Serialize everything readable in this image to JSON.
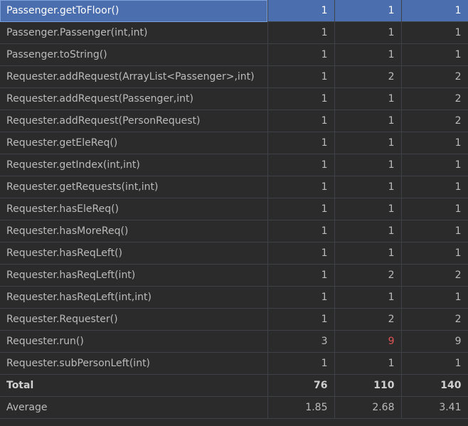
{
  "colors": {
    "background": "#2b2b2b",
    "selected_row": "#4b6eaf",
    "highlight_value": "#e05555"
  },
  "rows": [
    {
      "method": "Passenger.getToFloor()",
      "a": "1",
      "b": "1",
      "c": "1"
    },
    {
      "method": "Passenger.Passenger(int,int)",
      "a": "1",
      "b": "1",
      "c": "1"
    },
    {
      "method": "Passenger.toString()",
      "a": "1",
      "b": "1",
      "c": "1"
    },
    {
      "method": "Requester.addRequest(ArrayList<Passenger>,int)",
      "a": "1",
      "b": "2",
      "c": "2"
    },
    {
      "method": "Requester.addRequest(Passenger,int)",
      "a": "1",
      "b": "1",
      "c": "2"
    },
    {
      "method": "Requester.addRequest(PersonRequest)",
      "a": "1",
      "b": "1",
      "c": "2"
    },
    {
      "method": "Requester.getEleReq()",
      "a": "1",
      "b": "1",
      "c": "1"
    },
    {
      "method": "Requester.getIndex(int,int)",
      "a": "1",
      "b": "1",
      "c": "1"
    },
    {
      "method": "Requester.getRequests(int,int)",
      "a": "1",
      "b": "1",
      "c": "1"
    },
    {
      "method": "Requester.hasEleReq()",
      "a": "1",
      "b": "1",
      "c": "1"
    },
    {
      "method": "Requester.hasMoreReq()",
      "a": "1",
      "b": "1",
      "c": "1"
    },
    {
      "method": "Requester.hasReqLeft()",
      "a": "1",
      "b": "1",
      "c": "1"
    },
    {
      "method": "Requester.hasReqLeft(int)",
      "a": "1",
      "b": "2",
      "c": "2"
    },
    {
      "method": "Requester.hasReqLeft(int,int)",
      "a": "1",
      "b": "1",
      "c": "1"
    },
    {
      "method": "Requester.Requester()",
      "a": "1",
      "b": "2",
      "c": "2"
    },
    {
      "method": "Requester.run()",
      "a": "3",
      "b": "9",
      "c": "9"
    },
    {
      "method": "Requester.subPersonLeft(int)",
      "a": "1",
      "b": "1",
      "c": "1"
    }
  ],
  "total": {
    "label": "Total",
    "a": "76",
    "b": "110",
    "c": "140"
  },
  "average": {
    "label": "Average",
    "a": "1.85",
    "b": "2.68",
    "c": "3.41"
  }
}
